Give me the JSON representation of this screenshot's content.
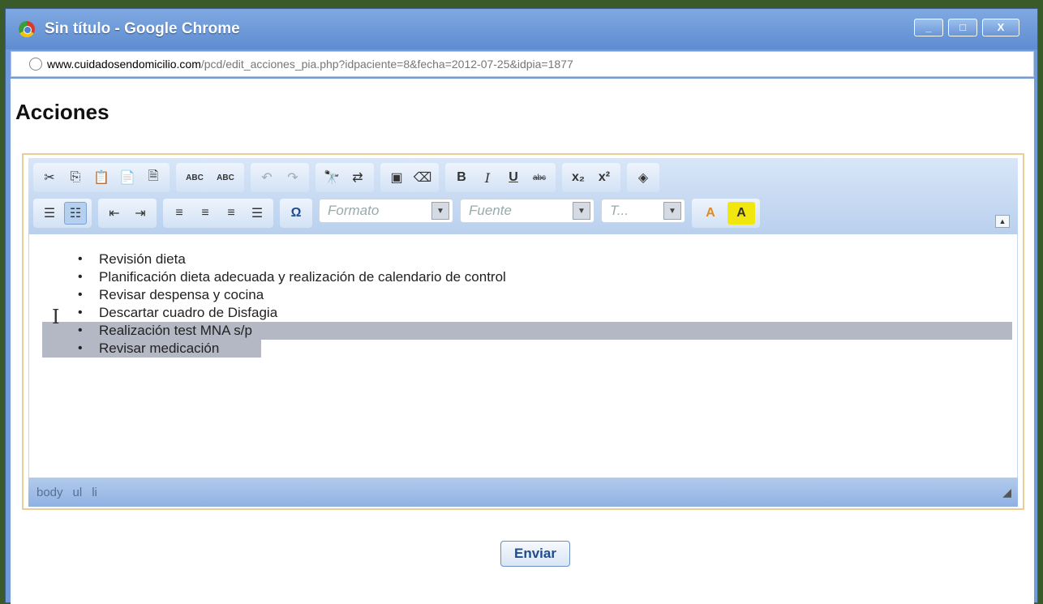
{
  "window": {
    "title": "Sin título - Google Chrome",
    "controls": [
      "_",
      "□",
      "X"
    ]
  },
  "url": {
    "host": "www.cuidadosendomicilio.com",
    "path": "/pcd/edit_acciones_pia.php?idpaciente=8&fecha=2012-07-25&idpia=1877"
  },
  "page": {
    "heading": "Acciones"
  },
  "toolbar": {
    "row1_icons": [
      "cut-icon",
      "copy-icon",
      "paste-icon",
      "paste-text-icon",
      "paste-word-icon",
      "spellcheck-icon",
      "spellcheck-dropdown-icon",
      "undo-icon",
      "redo-icon",
      "find-icon",
      "replace-icon",
      "select-all-icon",
      "remove-format-icon",
      "bold-icon",
      "italic-icon",
      "underline-icon",
      "strikethrough-icon",
      "subscript-icon",
      "superscript-icon",
      "source-icon"
    ],
    "row2_icons": [
      "numbered-list-icon",
      "bulleted-list-icon",
      "outdent-icon",
      "indent-icon",
      "align-left-icon",
      "align-center-icon",
      "align-right-icon",
      "justify-icon",
      "special-char-icon",
      "text-color-icon",
      "bg-color-icon"
    ],
    "format_placeholder": "Formato",
    "font_placeholder": "Fuente",
    "size_placeholder": "T...",
    "bold": "B",
    "italic": "I",
    "underline": "U",
    "strike": "abc",
    "subscript": "x₂",
    "superscript": "x²",
    "omega": "Ω",
    "abc1": "ABC",
    "abc2": "ABC",
    "text_color": "A",
    "bg_color": "A"
  },
  "editor": {
    "items": [
      "Revisión dieta",
      "Planificación dieta adecuada y realización de calendario de control",
      "Revisar despensa y cocina",
      "Descartar cuadro de Disfagia",
      "Realización test MNA s/p",
      "Revisar medicación"
    ]
  },
  "status": {
    "path": [
      "body",
      "ul",
      "li"
    ]
  },
  "submit": {
    "label": "Enviar"
  }
}
